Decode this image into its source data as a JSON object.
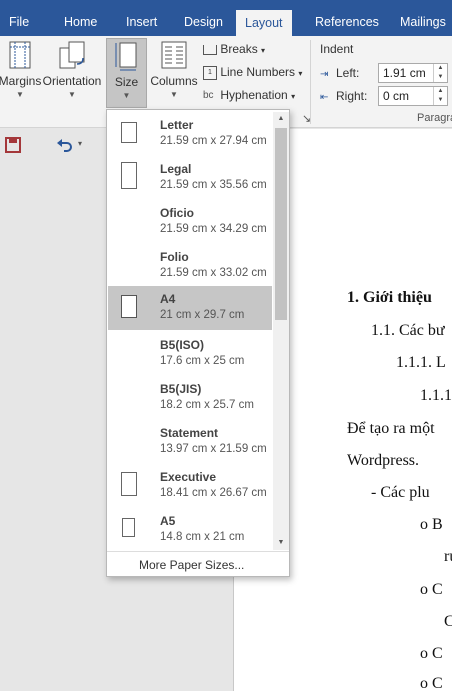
{
  "tabs": [
    "File",
    "Home",
    "Insert",
    "Design",
    "Layout",
    "References",
    "Mailings"
  ],
  "ribbon": {
    "margins": "Margins",
    "orientation": "Orientation",
    "size": "Size",
    "columns": "Columns",
    "breaks": "Breaks",
    "line_numbers": "Line Numbers",
    "hyphenation": "Hyphenation",
    "indent_label": "Indent",
    "left_label": "Left:",
    "left_value": "1.91 cm",
    "right_label": "Right:",
    "right_value": "0 cm",
    "paragraph_group": "Paragra"
  },
  "paper_sizes": [
    {
      "name": "Letter",
      "dims": "21.59 cm x 27.94 cm",
      "selected": false
    },
    {
      "name": "Legal",
      "dims": "21.59 cm x 35.56 cm",
      "selected": false
    },
    {
      "name": "Oficio",
      "dims": "21.59 cm x 34.29 cm",
      "selected": false
    },
    {
      "name": "Folio",
      "dims": "21.59 cm x 33.02 cm",
      "selected": false
    },
    {
      "name": "A4",
      "dims": "21 cm x 29.7 cm",
      "selected": true
    },
    {
      "name": "B5(ISO)",
      "dims": "17.6 cm x 25 cm",
      "selected": false
    },
    {
      "name": "B5(JIS)",
      "dims": "18.2 cm x 25.7 cm",
      "selected": false
    },
    {
      "name": "Statement",
      "dims": "13.97 cm x 21.59 cm",
      "selected": false
    },
    {
      "name": "Executive",
      "dims": "18.41 cm x 26.67 cm",
      "selected": false
    },
    {
      "name": "A5",
      "dims": "14.8 cm x 21 cm",
      "selected": false
    }
  ],
  "more_sizes": "More Paper Sizes...",
  "document": {
    "l1": "1.  Giới thiệu",
    "l2": "1.1. Các bư",
    "l3": "1.1.1. L",
    "l4": "1.1.1",
    "l5": "Để tạo ra một",
    "l6": "Wordpress.",
    "l7": "-    Các plu",
    "l8": "o    B",
    "l9": "ru",
    "l10": "o    C",
    "l11": "C",
    "l12": "o    C",
    "l13": "o    C"
  },
  "colors": {
    "accent": "#2b579a",
    "ribbon": "#f3f3f3",
    "selected": "#c6c6c6",
    "save": "#a4373a",
    "undo": "#2b579a"
  }
}
